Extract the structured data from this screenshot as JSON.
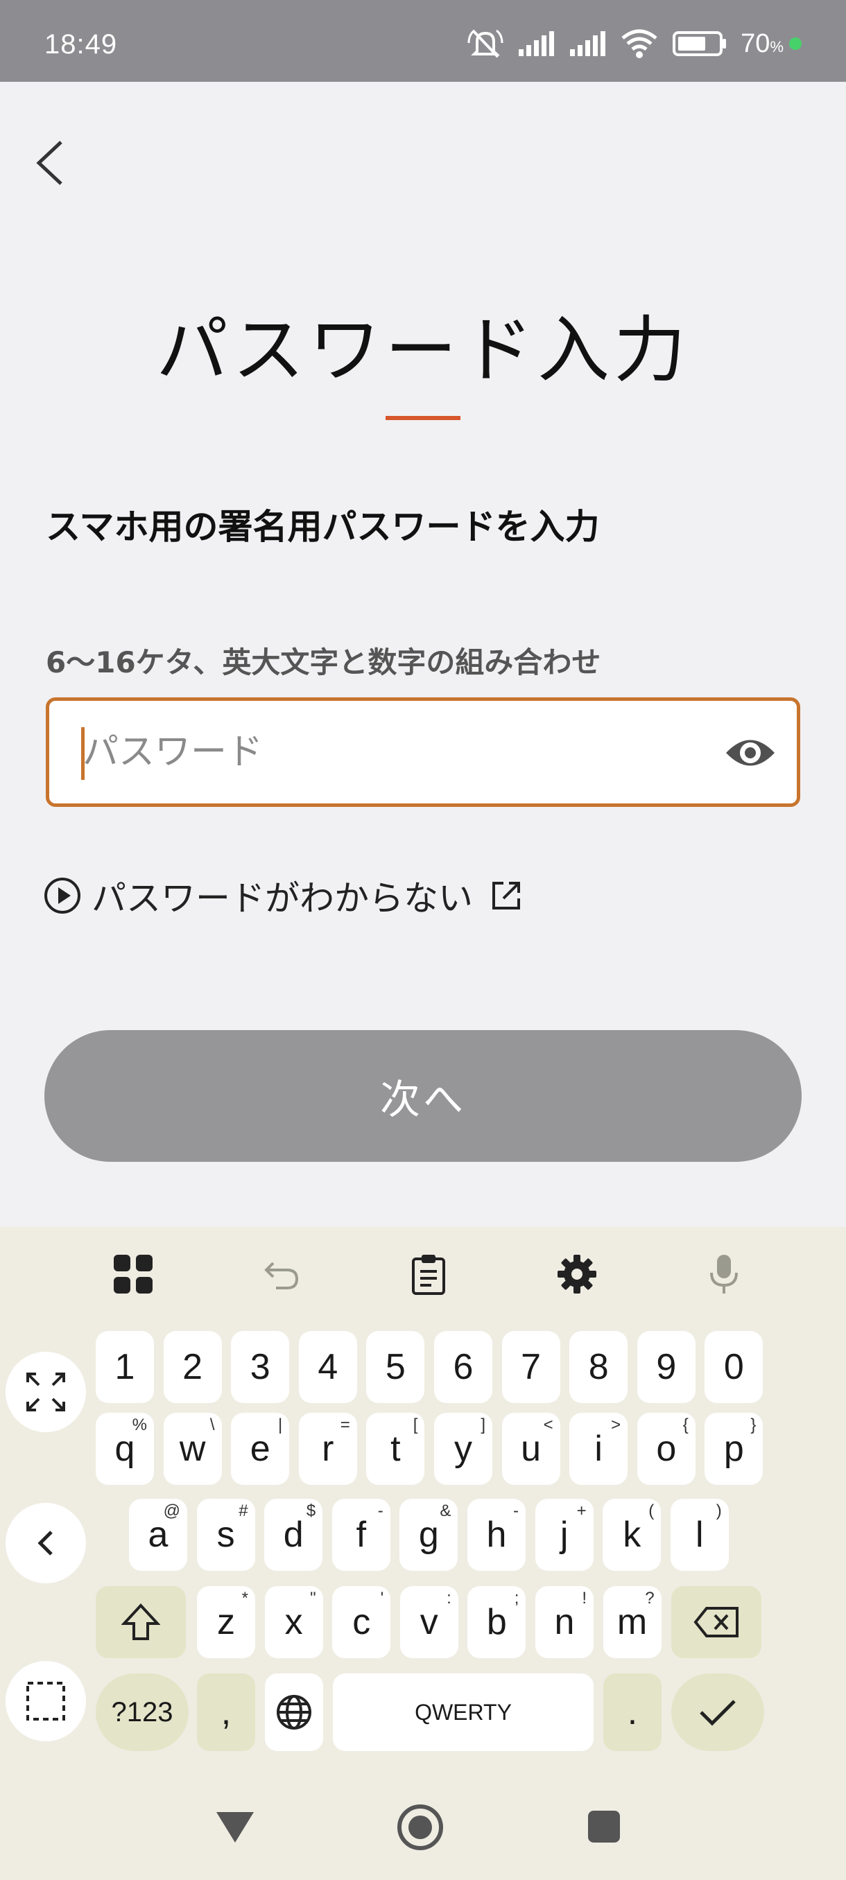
{
  "status_bar": {
    "time": "18:49",
    "battery_percent": "70",
    "battery_unit": "%",
    "battery_level": 0.7
  },
  "page": {
    "title": "パスワード入力",
    "subtitle": "スマホ用の署名用パスワードを入力",
    "field_hint": "6〜16ケタ、英大文字と数字の組み合わせ",
    "password_placeholder": "パスワード",
    "forgot_link": "パスワードがわからない",
    "next_button": "次へ"
  },
  "icons": {
    "back": "chevron-left-icon",
    "eye": "eye-icon",
    "play": "play-circle-icon",
    "external": "external-link-icon",
    "apps": "apps-grid-icon",
    "undo": "undo-icon",
    "clipboard": "clipboard-icon",
    "settings": "gear-icon",
    "mic": "mic-icon"
  },
  "colors": {
    "accent": "#d7562b",
    "field_border": "#c8742d",
    "button_disabled": "#969698",
    "keyboard_bg": "#efede2",
    "func_key": "#e4e4c8"
  },
  "keyboard": {
    "row_numbers": [
      "1",
      "2",
      "3",
      "4",
      "5",
      "6",
      "7",
      "8",
      "9",
      "0"
    ],
    "row_q": [
      [
        "q",
        "%"
      ],
      [
        "w",
        "\\"
      ],
      [
        "e",
        "|"
      ],
      [
        "r",
        "="
      ],
      [
        "t",
        "["
      ],
      [
        "y",
        "]"
      ],
      [
        "u",
        "<"
      ],
      [
        "i",
        ">"
      ],
      [
        "o",
        "{"
      ],
      [
        "p",
        "}"
      ]
    ],
    "row_a": [
      [
        "a",
        "@"
      ],
      [
        "s",
        "#"
      ],
      [
        "d",
        "$"
      ],
      [
        "f",
        "-"
      ],
      [
        "g",
        "&"
      ],
      [
        "h",
        "-"
      ],
      [
        "j",
        "+"
      ],
      [
        "k",
        "("
      ],
      [
        "l",
        ")"
      ]
    ],
    "row_z": [
      [
        "z",
        "*"
      ],
      [
        "x",
        "\""
      ],
      [
        "c",
        "'"
      ],
      [
        "v",
        ":"
      ],
      [
        "b",
        ";"
      ],
      [
        "n",
        "!"
      ],
      [
        "m",
        "?"
      ]
    ],
    "symbols_key": "?123",
    "comma_key": ",",
    "space_label": "QWERTY",
    "period_key": "."
  }
}
